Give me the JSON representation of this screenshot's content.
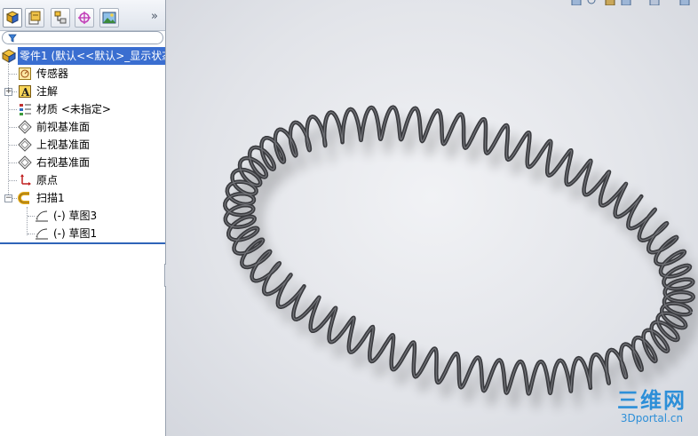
{
  "panel": {
    "tabs": [
      {
        "icon": "feature-manager-icon"
      },
      {
        "icon": "property-manager-icon"
      },
      {
        "icon": "configuration-manager-icon"
      },
      {
        "icon": "dimxpert-icon"
      },
      {
        "icon": "display-manager-icon"
      }
    ],
    "more": "»",
    "filter_icon": "filter-icon"
  },
  "tree": {
    "root": "零件1  (默认<<默认>_显示状态",
    "items": [
      {
        "label": "传感器",
        "icon": "sensor-icon"
      },
      {
        "label": "注解",
        "icon": "annotation-icon"
      },
      {
        "label": "材质 <未指定>",
        "icon": "material-icon"
      },
      {
        "label": "前视基准面",
        "icon": "plane-icon"
      },
      {
        "label": "上视基准面",
        "icon": "plane-icon"
      },
      {
        "label": "右视基准面",
        "icon": "plane-icon"
      },
      {
        "label": "原点",
        "icon": "origin-icon"
      },
      {
        "label": "扫描1",
        "icon": "sweep-icon"
      },
      {
        "label": "(-) 草图3",
        "icon": "sketch-icon"
      },
      {
        "label": "(-) 草图1",
        "icon": "sketch-icon"
      }
    ]
  },
  "watermark": {
    "logo": "三维网",
    "site": "3Dportal.cn"
  },
  "colors": {
    "selection": "#3a6ed0",
    "spring": "#3a3b3f",
    "watermark": "#2d8fd8"
  }
}
